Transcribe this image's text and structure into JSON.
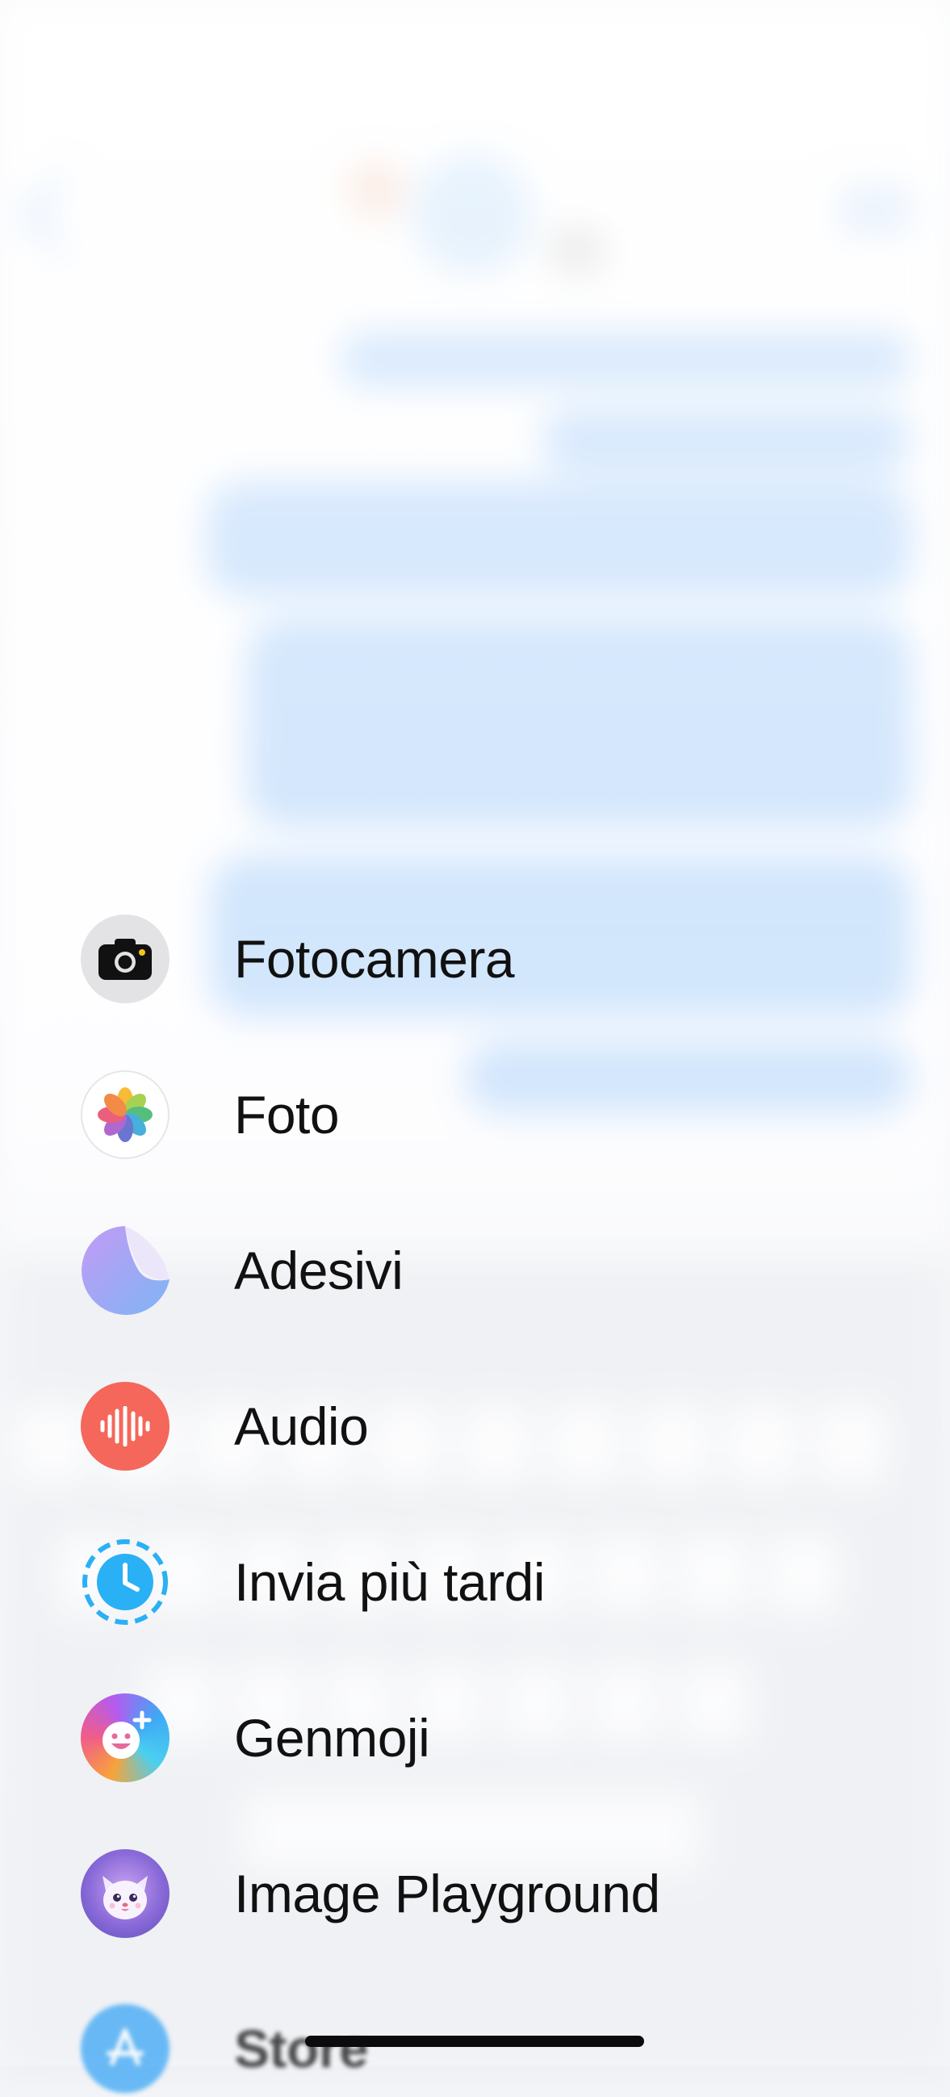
{
  "menu": {
    "items": [
      {
        "id": "camera",
        "label": "Fotocamera",
        "icon": "camera-icon"
      },
      {
        "id": "photos",
        "label": "Foto",
        "icon": "photos-icon"
      },
      {
        "id": "stickers",
        "label": "Adesivi",
        "icon": "stickers-icon"
      },
      {
        "id": "audio",
        "label": "Audio",
        "icon": "audio-waveform-icon"
      },
      {
        "id": "send-later",
        "label": "Invia più tardi",
        "icon": "clock-dashed-icon"
      },
      {
        "id": "genmoji",
        "label": "Genmoji",
        "icon": "genmoji-icon"
      },
      {
        "id": "image-playground",
        "label": "Image Playground",
        "icon": "image-playground-icon"
      },
      {
        "id": "store",
        "label": "Store",
        "icon": "app-store-icon"
      }
    ]
  },
  "colors": {
    "bubble": "#b9d8fb",
    "audio": "#f4675a",
    "send_later": "#2ab0f5",
    "store": "#3aa6f5",
    "camera_bg": "#e3e3e6"
  }
}
